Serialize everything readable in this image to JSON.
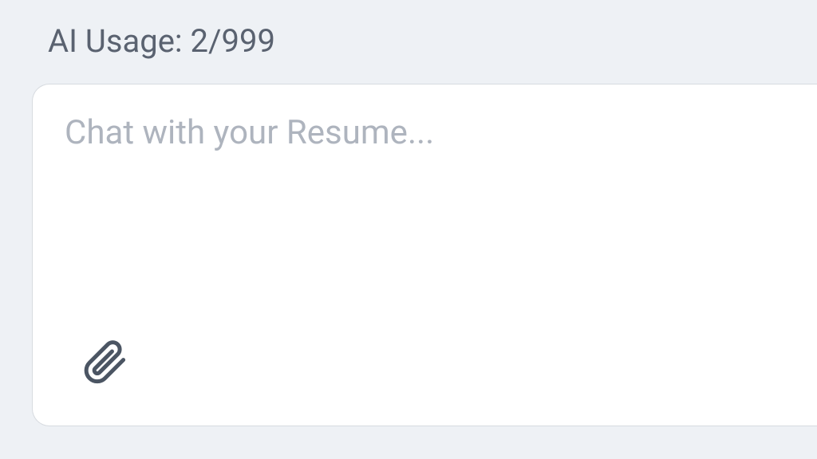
{
  "usage": {
    "label": "AI Usage: 2/999"
  },
  "chat": {
    "placeholder": "Chat with your Resume...",
    "value": ""
  },
  "icons": {
    "attach": "paperclip-icon"
  }
}
